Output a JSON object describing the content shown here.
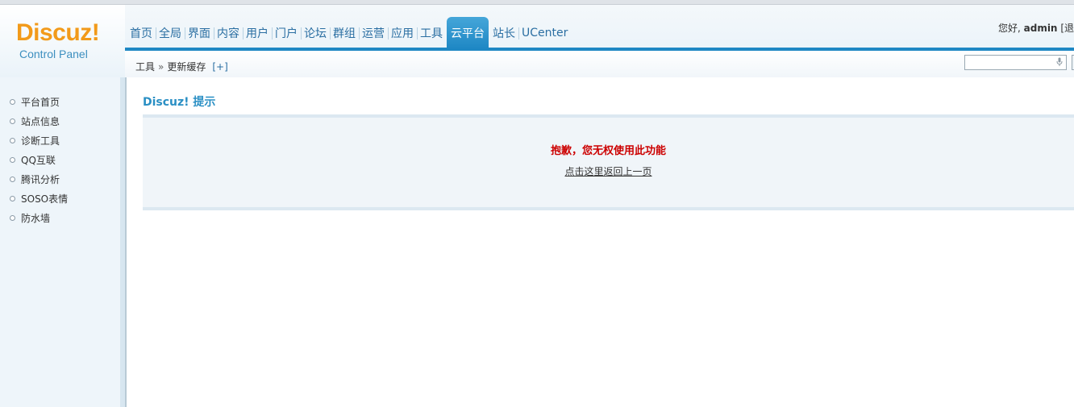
{
  "logo": {
    "main": "Discuz!",
    "sub": "Control Panel"
  },
  "nav": [
    {
      "label": "首页"
    },
    {
      "label": "全局"
    },
    {
      "label": "界面"
    },
    {
      "label": "内容"
    },
    {
      "label": "用户"
    },
    {
      "label": "门户"
    },
    {
      "label": "论坛"
    },
    {
      "label": "群组"
    },
    {
      "label": "运营"
    },
    {
      "label": "应用"
    },
    {
      "label": "工具"
    },
    {
      "label": "云平台",
      "active": true
    },
    {
      "label": "站长"
    },
    {
      "label": "UCenter"
    }
  ],
  "user": {
    "greeting": "您好,",
    "name": "admin",
    "logout": "[退"
  },
  "breadcrumb": {
    "section": "工具",
    "separator": "»",
    "page": "更新缓存",
    "add": "[+]"
  },
  "search": {
    "value": "",
    "placeholder": ""
  },
  "sidebar": {
    "items": [
      {
        "label": "平台首页"
      },
      {
        "label": "站点信息"
      },
      {
        "label": "诊断工具"
      },
      {
        "label": "QQ互联"
      },
      {
        "label": "腾讯分析"
      },
      {
        "label": "SOSO表情"
      },
      {
        "label": "防水墙"
      }
    ]
  },
  "main": {
    "title": "Discuz! 提示",
    "message": "抱歉，您无权使用此功能",
    "back_link": "点击这里返回上一页"
  },
  "colors": {
    "accent": "#1e87c4",
    "logo": "#f29a1a",
    "error": "#cc0000",
    "title": "#2a8fc4"
  },
  "icons": {
    "search": "microphone-icon",
    "sidebar_bullet": "circle-bullet-icon"
  }
}
